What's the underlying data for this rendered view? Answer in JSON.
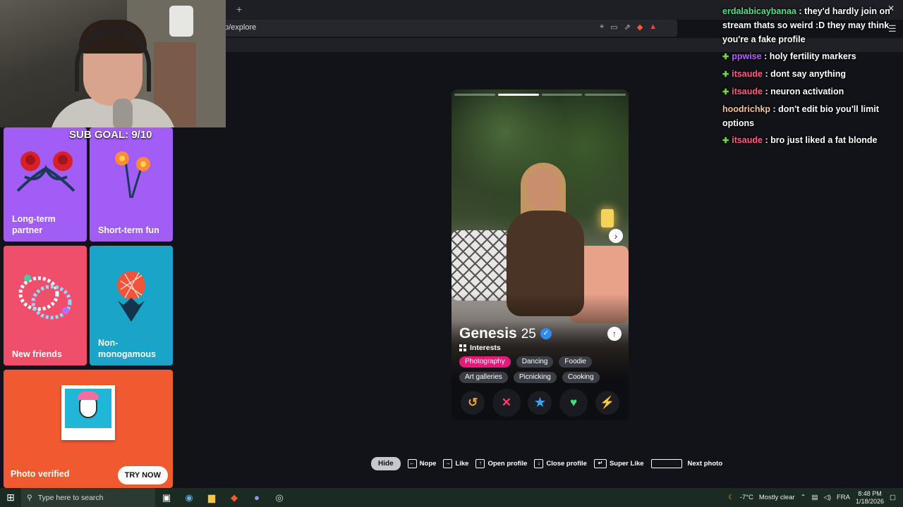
{
  "browser": {
    "newtab": "+",
    "url": "p/explore"
  },
  "sub_goal": "SUB GOAL: 9/10",
  "tiles": [
    {
      "label": "Long-term partner"
    },
    {
      "label": "Short-term fun"
    },
    {
      "label": "New friends"
    },
    {
      "label": "Non-monogamous"
    },
    {
      "label": "Photo verified",
      "button": "TRY NOW"
    }
  ],
  "profile": {
    "name": "Genesis",
    "age": "25",
    "interests_heading": "Interests",
    "interests": [
      {
        "label": "Photography",
        "highlight": true
      },
      {
        "label": "Dancing"
      },
      {
        "label": "Foodie"
      },
      {
        "label": "Art galleries"
      },
      {
        "label": "Picnicking"
      },
      {
        "label": "Cooking"
      }
    ],
    "photo_count": 4,
    "active_photo": 1
  },
  "actions": {
    "rewind": "↺",
    "nope": "✕",
    "superlike": "★",
    "like": "♥",
    "boost": "⚡",
    "colors": {
      "rewind": "#f5a623",
      "nope": "#ff3b6b",
      "superlike": "#2ea8ff",
      "like": "#3ee07a",
      "boost": "#a33bff"
    }
  },
  "hotkeys": {
    "hide": "Hide",
    "nope": "Nope",
    "like": "Like",
    "open_profile": "Open profile",
    "close_profile": "Close profile",
    "super_like": "Super Like",
    "next_photo": "Next photo"
  },
  "chat": [
    {
      "user": "erdalabicaybanaa",
      "text": " : they'd hardly join on stream thats so weird :D they may think you're a fake profile"
    },
    {
      "user": "ppwise",
      "text": " : holy fertility markers"
    },
    {
      "user": "itsaude",
      "text": " : dont say anything"
    },
    {
      "user": "itsaude",
      "text": " : neuron activation"
    },
    {
      "user": "hoodrichkp",
      "text": " : don't edit bio you'll limit options"
    },
    {
      "user": "itsaude",
      "text": " : bro just liked a fat blonde"
    }
  ],
  "taskbar": {
    "search_placeholder": "Type here to search",
    "weather": "-7°C",
    "weather_text": "Mostly clear",
    "lang": "FRA",
    "time": "8:48 PM",
    "date": "1/18/2026"
  }
}
